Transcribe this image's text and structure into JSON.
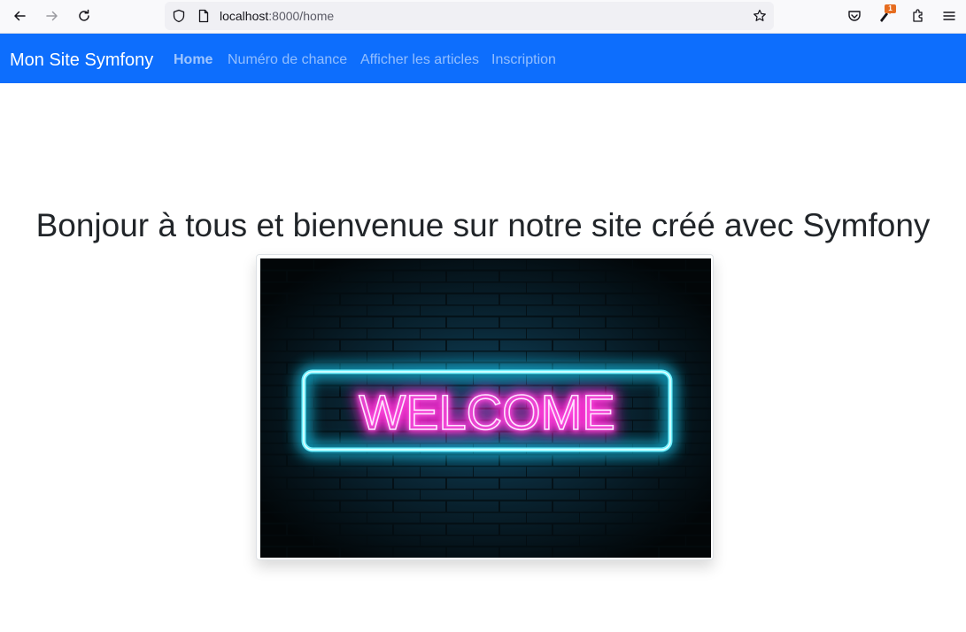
{
  "browser": {
    "url_host": "localhost",
    "url_rest": ":8000/home",
    "extension_badge": "1"
  },
  "navbar": {
    "brand": "Mon Site Symfony",
    "links": [
      "Home",
      "Numéro de chance",
      "Afficher les articles",
      "Inscription"
    ],
    "color": "#0d6efd"
  },
  "main": {
    "heading": "Bonjour à tous et bienvenue sur notre site créé avec Symfony",
    "image_text": "WELCOME"
  }
}
